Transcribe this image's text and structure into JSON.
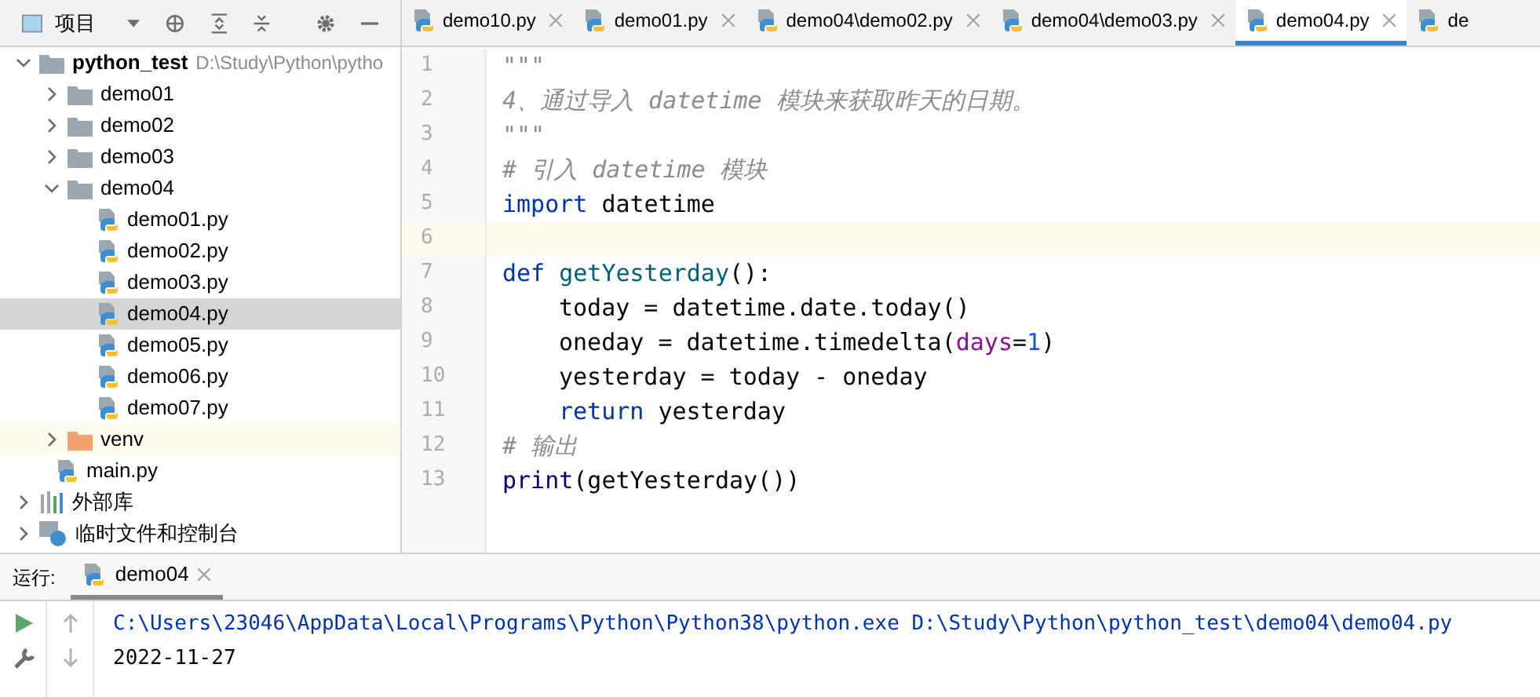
{
  "project_panel": {
    "title": "项目"
  },
  "tree": [
    {
      "label": "python_test",
      "hint": "D:\\Study\\Python\\pytho",
      "kind": "root",
      "expanded": true,
      "selected": false,
      "children": [
        {
          "label": "demo01",
          "kind": "folder",
          "expanded": false,
          "selected": false
        },
        {
          "label": "demo02",
          "kind": "folder",
          "expanded": false,
          "selected": false
        },
        {
          "label": "demo03",
          "kind": "folder",
          "expanded": false,
          "selected": false
        },
        {
          "label": "demo04",
          "kind": "folder",
          "expanded": true,
          "selected": false,
          "children": [
            {
              "label": "demo01.py",
              "kind": "file",
              "selected": false
            },
            {
              "label": "demo02.py",
              "kind": "file",
              "selected": false
            },
            {
              "label": "demo03.py",
              "kind": "file",
              "selected": false
            },
            {
              "label": "demo04.py",
              "kind": "file",
              "selected": true
            },
            {
              "label": "demo05.py",
              "kind": "file",
              "selected": false
            },
            {
              "label": "demo06.py",
              "kind": "file",
              "selected": false
            },
            {
              "label": "demo07.py",
              "kind": "file",
              "selected": false
            }
          ]
        },
        {
          "label": "venv",
          "kind": "excluded",
          "expanded": false,
          "selected": false
        },
        {
          "label": "main.py",
          "kind": "file",
          "selected": false
        }
      ]
    },
    {
      "label": "外部库",
      "kind": "library",
      "expanded": false,
      "selected": false
    },
    {
      "label": "临时文件和控制台",
      "kind": "scratch",
      "expanded": false,
      "selected": false
    }
  ],
  "tabs": [
    {
      "label": "demo10.py",
      "selected": false
    },
    {
      "label": "demo01.py",
      "selected": false
    },
    {
      "label": "demo04\\demo02.py",
      "selected": false
    },
    {
      "label": "demo04\\demo03.py",
      "selected": false
    },
    {
      "label": "demo04.py",
      "selected": true
    },
    {
      "label": "de",
      "selected": false
    }
  ],
  "code": [
    {
      "number": "1",
      "current": false,
      "tokens": [
        {
          "kind": "doc",
          "text": "\"\"\""
        }
      ]
    },
    {
      "number": "2",
      "current": false,
      "tokens": [
        {
          "kind": "doc",
          "text": "4、通过导入 datetime 模块来获取昨天的日期。"
        }
      ]
    },
    {
      "number": "3",
      "current": false,
      "tokens": [
        {
          "kind": "doc",
          "text": "\"\"\""
        }
      ]
    },
    {
      "number": "4",
      "current": false,
      "tokens": [
        {
          "kind": "comment",
          "text": "# 引入 datetime 模块"
        }
      ]
    },
    {
      "number": "5",
      "current": false,
      "tokens": [
        {
          "kind": "keyword",
          "text": "import"
        },
        {
          "kind": "plain",
          "text": " datetime"
        }
      ]
    },
    {
      "number": "6",
      "current": true
    },
    {
      "number": "7",
      "current": false,
      "tokens": [
        {
          "kind": "keyword",
          "text": "def"
        },
        {
          "kind": "function",
          "text": " getYesterday"
        },
        {
          "kind": "plain",
          "text": "():"
        }
      ]
    },
    {
      "number": "8",
      "current": false,
      "indent": true,
      "tokens": [
        {
          "kind": "plain",
          "text": "today = datetime.date.today()"
        }
      ]
    },
    {
      "number": "9",
      "current": false,
      "indent": true,
      "tokens": [
        {
          "kind": "plain",
          "text": "oneday = datetime.timedelta("
        },
        {
          "kind": "param",
          "text": "days"
        },
        {
          "kind": "plain",
          "text": "="
        },
        {
          "kind": "number",
          "text": "1"
        },
        {
          "kind": "plain",
          "text": ")"
        }
      ]
    },
    {
      "number": "10",
      "current": false,
      "indent": true,
      "tokens": [
        {
          "kind": "plain",
          "text": "yesterday = today - oneday"
        }
      ]
    },
    {
      "number": "11",
      "current": false,
      "indent": true,
      "tokens": [
        {
          "kind": "keyword",
          "text": "return"
        },
        {
          "kind": "plain",
          "text": " yesterday"
        }
      ]
    },
    {
      "number": "12",
      "current": false,
      "tokens": [
        {
          "kind": "comment",
          "text": "# 输出"
        }
      ]
    },
    {
      "number": "13",
      "current": false,
      "tokens": [
        {
          "kind": "builtin",
          "text": "print"
        },
        {
          "kind": "plain",
          "text": "(getYesterday())"
        }
      ]
    }
  ],
  "run_panel": {
    "label": "运行:",
    "tab": "demo04",
    "output": [
      {
        "kind": "command",
        "text": "C:\\Users\\23046\\AppData\\Local\\Programs\\Python\\Python38\\python.exe D:\\Study\\Python\\python_test\\demo04\\demo04.py"
      },
      {
        "kind": "stdout",
        "text": "2022-11-27"
      }
    ]
  }
}
